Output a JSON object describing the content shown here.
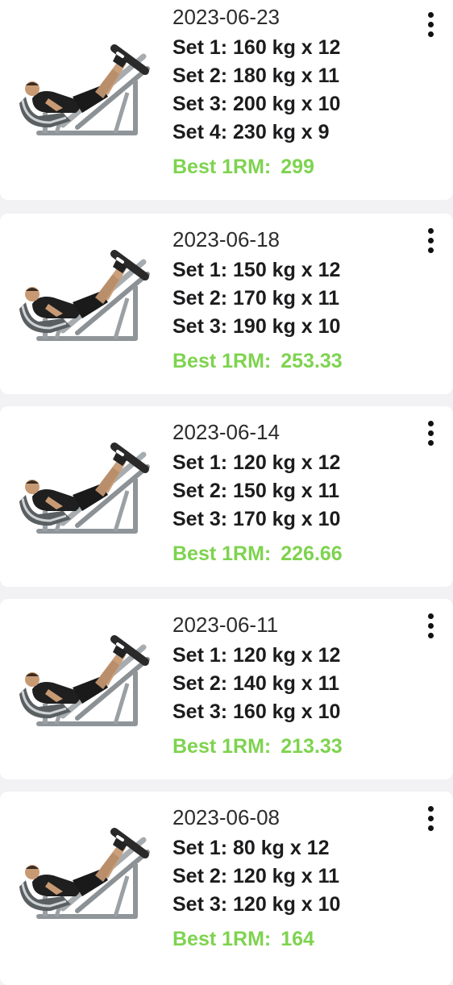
{
  "workouts": [
    {
      "date": "2023-06-23",
      "sets": [
        "Set 1: 160 kg x 12",
        "Set 2: 180 kg x 11",
        "Set 3: 200 kg x 10",
        "Set 4: 230 kg x 9"
      ],
      "best_label": "Best 1RM:",
      "best_value": "299"
    },
    {
      "date": "2023-06-18",
      "sets": [
        "Set 1: 150 kg x 12",
        "Set 2: 170 kg x 11",
        "Set 3: 190 kg x 10"
      ],
      "best_label": "Best 1RM:",
      "best_value": "253.33"
    },
    {
      "date": "2023-06-14",
      "sets": [
        "Set 1: 120 kg x 12",
        "Set 2: 150 kg x 11",
        "Set 3: 170 kg x 10"
      ],
      "best_label": "Best 1RM:",
      "best_value": "226.66"
    },
    {
      "date": "2023-06-11",
      "sets": [
        "Set 1: 120 kg x 12",
        "Set 2: 140 kg x 11",
        "Set 3: 160 kg x 10"
      ],
      "best_label": "Best 1RM:",
      "best_value": "213.33"
    },
    {
      "date": "2023-06-08",
      "sets": [
        "Set 1: 80 kg x 12",
        "Set 2: 120 kg x 11",
        "Set 3: 120 kg x 10"
      ],
      "best_label": "Best 1RM:",
      "best_value": "164"
    }
  ],
  "icons": {
    "exercise_image": "leg-press-icon",
    "menu": "more-vertical-icon"
  },
  "colors": {
    "best_1rm": "#7ed34f",
    "card_bg": "#ffffff",
    "separator_bg": "#f2f2f4"
  }
}
